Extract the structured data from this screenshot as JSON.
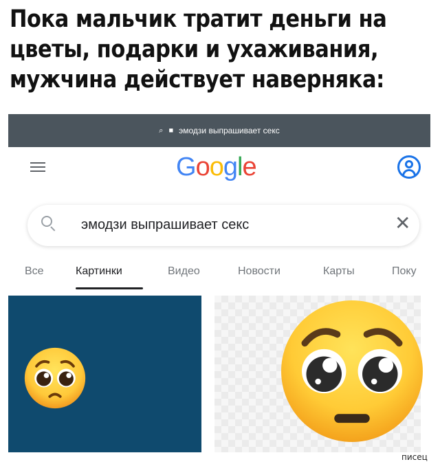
{
  "caption": {
    "line1": "Пока мальчик тратит деньги на",
    "line2": "цветы, подарки и ухаживания,",
    "line3": "мужчина действует наверняка:"
  },
  "browser": {
    "url_text": "эмодзи выпрашивает секс",
    "bar_color": "#4b555d"
  },
  "google": {
    "logo_letters": [
      {
        "ch": "G",
        "color": "#4285F4"
      },
      {
        "ch": "o",
        "color": "#EA4335"
      },
      {
        "ch": "o",
        "color": "#FBBC05"
      },
      {
        "ch": "g",
        "color": "#4285F4"
      },
      {
        "ch": "l",
        "color": "#34A853"
      },
      {
        "ch": "e",
        "color": "#EA4335"
      }
    ],
    "search_query": "эмодзи выпрашивает секс",
    "clear_symbol": "✕",
    "tabs": [
      "Все",
      "Картинки",
      "Видео",
      "Новости",
      "Карты",
      "Поку"
    ],
    "active_tab": "Картинки"
  },
  "results": {
    "thumb1_bg": "#0f4a6e",
    "emoji_name": "pleading-face-icon"
  },
  "watermark": "писец"
}
